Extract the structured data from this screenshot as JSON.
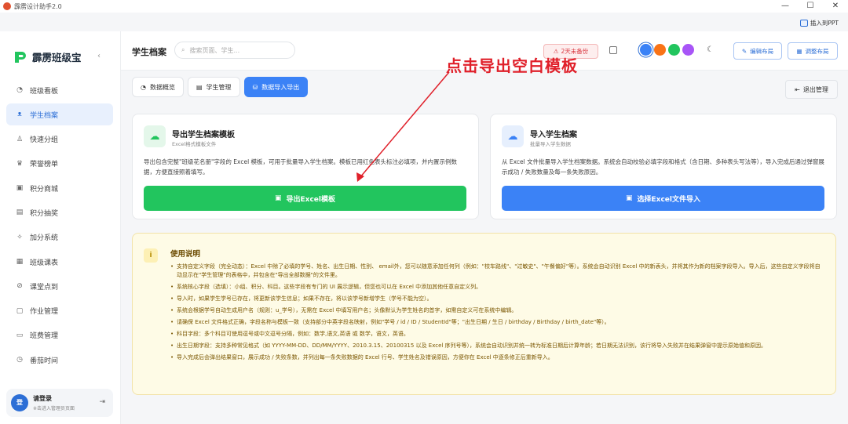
{
  "window": {
    "title": "霹雳设计助手2.0",
    "controls": [
      "—",
      "☐",
      "✕"
    ]
  },
  "top_action": {
    "label": "插入到PPT"
  },
  "brand": {
    "name": "霹雳班级宝"
  },
  "sidebar": {
    "items": [
      {
        "label": "班级看板",
        "icon": "◔",
        "active": false
      },
      {
        "label": "学生档案",
        "icon": "ᴥ",
        "active": true
      },
      {
        "label": "快速分组",
        "icon": "♙",
        "active": false
      },
      {
        "label": "荣誉榜单",
        "icon": "♛",
        "active": false
      },
      {
        "label": "积分商城",
        "icon": "▣",
        "active": false
      },
      {
        "label": "积分抽奖",
        "icon": "▤",
        "active": false
      },
      {
        "label": "加分系统",
        "icon": "✧",
        "active": false
      },
      {
        "label": "班级课表",
        "icon": "▦",
        "active": false
      },
      {
        "label": "课堂点到",
        "icon": "⊘",
        "active": false
      },
      {
        "label": "作业管理",
        "icon": "▢",
        "active": false
      },
      {
        "label": "班费管理",
        "icon": "▭",
        "active": false
      },
      {
        "label": "番茄时间",
        "icon": "◷",
        "active": false
      }
    ],
    "login": {
      "avatar": "登",
      "title": "请登录",
      "subtitle": "※击进入管理员页面"
    }
  },
  "header": {
    "title": "学生档案",
    "search_placeholder": "搜索页面、学生...",
    "backup_badge": "2天未备份",
    "theme_colors": [
      "#3b82f6",
      "#f97316",
      "#22c55e",
      "#a855f7"
    ],
    "edit_layout": "编辑布局",
    "adjust_layout": "调整布局"
  },
  "tabs": [
    {
      "label": "数据概览",
      "active": false
    },
    {
      "label": "学生管理",
      "active": false
    },
    {
      "label": "数据导入导出",
      "active": true
    }
  ],
  "exit_button": "退出管理",
  "export_card": {
    "title": "导出学生档案模板",
    "subtitle": "Excel格式模板文件",
    "description": "导出包含完整\"班级花名册\"字段的 Excel 模板，可用于批量导入学生档案。模板已用红色表头标注必填项，并内置示例数据，方便直接照着填写。",
    "button": "导出Excel模板",
    "color": "#22c55e"
  },
  "import_card": {
    "title": "导入学生档案",
    "subtitle": "批量导入学生数据",
    "description": "从 Excel 文件批量导入学生档案数据。系统会自动校验必填字段和格式（含日期、多种表头写法等），导入完成后通过弹窗展示成功 / 失败数量及每一条失败原因。",
    "button": "选择Excel文件导入",
    "color": "#3b82f6"
  },
  "notes": {
    "title": "使用说明",
    "items": [
      "支持自定义字段（完全动态）：Excel 中除了必填的学号、姓名、出生日期、性别、 email外，您可以随意添加任何列（例如：\"校车路线\"、\"过敏史\"、\"午餐偏好\"等）。系统会自动识别 Excel 中的新表头，并将其作为新的档案字段导入。导入后，这些自定义字段将自动显示在\"学生管理\"的表格中，并包含在\"导出全部数据\"的文件里。",
      "系统核心字段（选填）：小组、积分、科目。这些字段有专门的 UI 展示逻辑，但您也可以在 Excel 中添加其他任意自定义列。",
      "导入时，如果学生学号已存在，将更新该学生信息；如果不存在，将以该学号新增学生（学号不能为空）。",
      "系统会根据学号自动生成用户名（规则：u_学号），无需在 Excel 中填写用户名；头像默认为学生姓名的首字，如需自定义可在系统中编辑。",
      "请确保 Excel 文件格式正确，字段名称与模板一致（支持部分中英字段名映射，例如\"学号 / id / ID / StudentId\"等；\"出生日期 / 生日 / birthday / Birthday / birth_date\"等）。",
      "科目字段：多个科目可使用逗号或中文逗号分隔，例如：数学,语文,英语 或 数学，语文，英语。",
      "出生日期字段：支持多种常见格式（如 YYYY-MM-DD、DD/MM/YYYY、2010.3.15、20100315 以及 Excel 序列号等），系统会自动识别并统一转为标准日期后计算年龄；若日期无法识别，该行将导入失败并在结果弹窗中提示原始值和原因。",
      "导入完成后会弹出结果窗口，展示成功 / 失败条数，并列出每一条失败数据的 Excel 行号、学生姓名及错误原因，方便你在 Excel 中逐条修正后重新导入。"
    ]
  },
  "annotation": {
    "text": "点击导出空白模板",
    "color": "#e0202a"
  }
}
